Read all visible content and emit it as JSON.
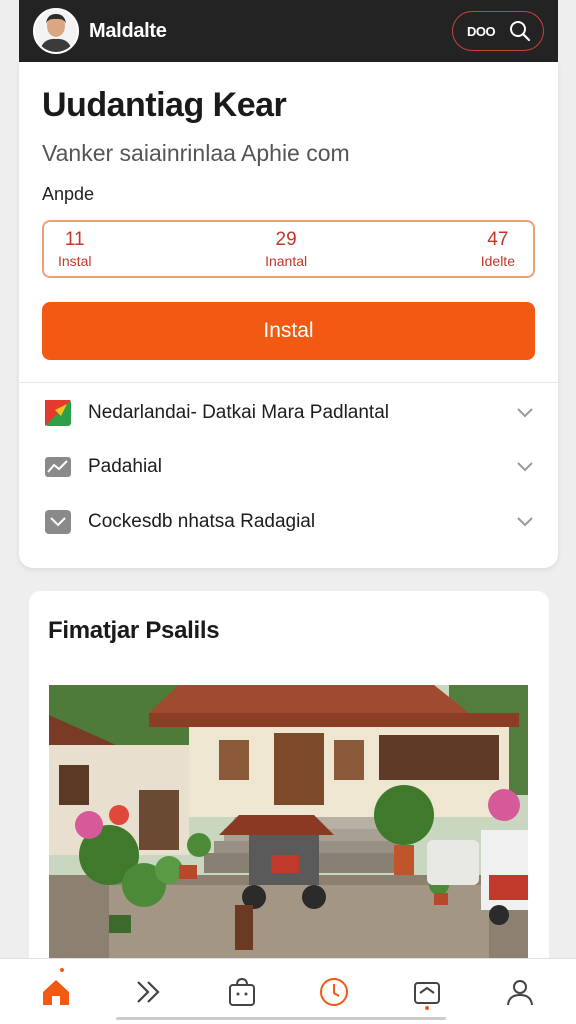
{
  "header": {
    "title": "Maldalte",
    "pill_text": "DOO",
    "avatar_icon": "person-avatar",
    "search_icon": "search-icon"
  },
  "main": {
    "title": "Uudantiag Kear",
    "subtitle": "Vanker saiainrinlaa Aphie com",
    "small_label": "Anpde",
    "stats": [
      {
        "value": "11",
        "label": "Instal"
      },
      {
        "value": "29",
        "label": "Inantal"
      },
      {
        "value": "47",
        "label": "Idelte"
      }
    ],
    "install_label": "Instal",
    "rows": [
      {
        "label": "Nedarlandai- Datkai Mara Padlantal",
        "icon": "flag-icon"
      },
      {
        "label": "Padahial",
        "icon": "chart-icon"
      },
      {
        "label": "Cockesdb nhatsa Radagial",
        "icon": "message-icon"
      }
    ]
  },
  "gallery": {
    "title": "Fimatjar Psalils"
  },
  "nav": {
    "items": [
      "home-icon",
      "forward-icon",
      "bag-icon",
      "clock-icon",
      "inbox-icon",
      "profile-icon"
    ],
    "active_color": "#f25a14"
  },
  "colors": {
    "accent": "#f25a14",
    "stat_text": "#c0392b",
    "header_bg": "#232323"
  }
}
